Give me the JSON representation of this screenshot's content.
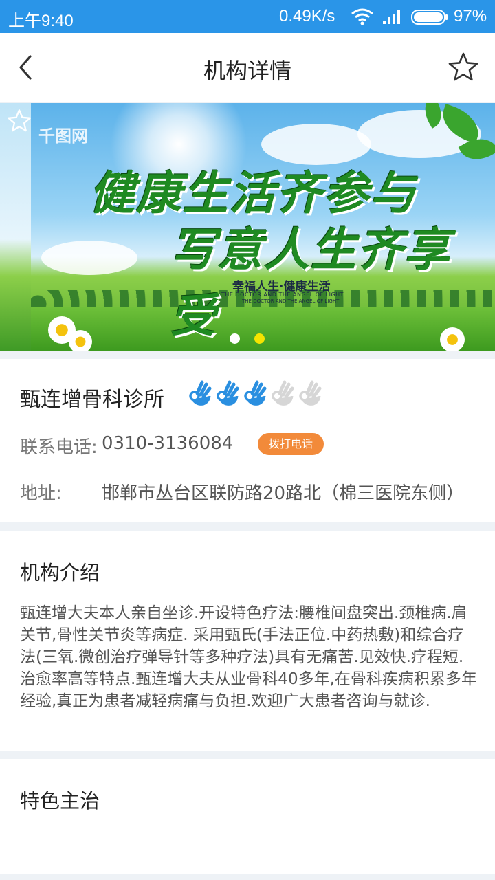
{
  "status_bar": {
    "time": "上午9:40",
    "net_speed": "0.49K/s",
    "battery_pct": "97%",
    "bg_color": "#2a95e8"
  },
  "header": {
    "title": "机构详情",
    "back_icon": "chevron-left-icon",
    "favorite_icon": "star-outline-icon"
  },
  "banner": {
    "watermark": "千图网",
    "slogan_line1": "健康生活齐参与",
    "slogan_line2": "写意人生齐享受",
    "subtitle": "幸福人生·健康生活",
    "subtitle_en": "THE DOCTOR AND THE ANGEL OF LIGHT",
    "subtitle_en2": "THE DOCTOR AND THE ANGEL OF LIGHT",
    "slide_count": 2,
    "active_slide": 2,
    "dot_inactive_color": "#ffffff",
    "dot_active_color": "#f5e400"
  },
  "clinic": {
    "name": "甄连增骨科诊所",
    "rating": 3,
    "rating_max": 5,
    "rating_color_on": "#2a8fe0",
    "rating_color_off": "#d6d6d6",
    "phone_label": "联系电话:",
    "phone": "0310-3136084",
    "call_button": "拨打电话",
    "call_button_color": "#f28a3a",
    "address_label": "地址:",
    "address": "邯郸市丛台区联防路20路北（棉三医院东侧）"
  },
  "intro": {
    "title": "机构介绍",
    "text": "甄连增大夫本人亲自坐诊.开设特色疗法:腰椎间盘突出.颈椎病.肩关节,骨性关节炎等病症. 采用甄氏(手法正位.中药热敷)和综合疗法(三氧.微创治疗弹导针等多种疗法)具有无痛苦.见效快.疗程短.治愈率高等特点.甄连增大夫从业骨科40多年,在骨科疾病积累多年经验,真正为患者减轻病痛与负担.欢迎广大患者咨询与就诊."
  },
  "features": {
    "title": "特色主治"
  }
}
